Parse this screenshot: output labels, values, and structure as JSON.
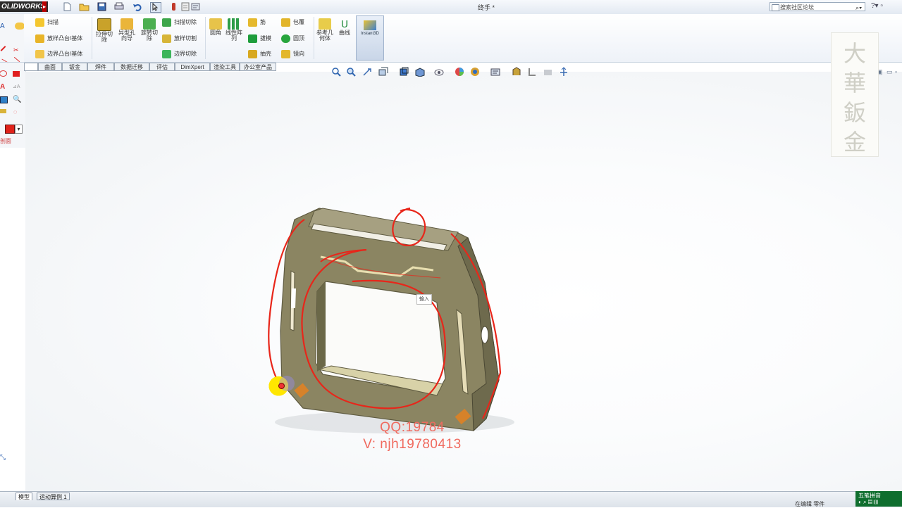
{
  "app": {
    "logo": "OLIDWORKS",
    "document_title": "终手 *",
    "search_placeholder": "搜索社区论坛"
  },
  "ribbon": {
    "sweep": "扫描",
    "loft_boss": "放样凸台/基体",
    "boundary_boss": "边界凸台/基体",
    "extruded_cut": "拉伸切除",
    "hole_wizard": "异型孔向导",
    "revolved_cut": "旋转切除",
    "swept_cut": "扫描切除",
    "lofted_cut": "放样切割",
    "boundary_cut": "边界切除",
    "fillet": "圆角",
    "linear_pattern": "线性阵列",
    "rib": "筋",
    "draft": "拔模",
    "shell": "抽壳",
    "wrap": "包覆",
    "intersect": "圆顶",
    "mirror": "镜向",
    "reference_geometry": "参考几何体",
    "curves": "曲线",
    "instant3d": "Instant3D"
  },
  "tabs": [
    "曲面",
    "钣金",
    "焊件",
    "数据迁移",
    "评估",
    "DimXpert",
    "渲染工具",
    "办公室产品"
  ],
  "left_panel": {
    "label": "剖面"
  },
  "viewport": {
    "tooltip": "输入"
  },
  "seal_chars": [
    "大",
    "華",
    "鈑",
    "金"
  ],
  "watermark": {
    "line1": "QQ:19784",
    "line2": "V: njh19780413"
  },
  "statusbar": {
    "model_tab": "模型",
    "motion_tab": "运动算例 1",
    "status": "在编辑 零件",
    "ime": "五笔拼音"
  },
  "colors": {
    "part_body": "#8b8562",
    "annotation": "#e8261a",
    "ime_bg": "#0f6e2e"
  }
}
